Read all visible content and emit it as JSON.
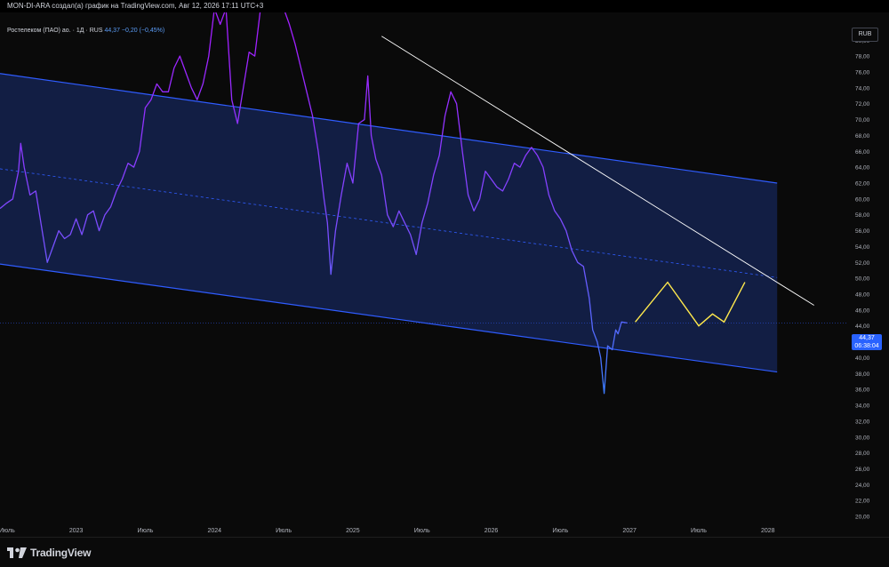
{
  "credit": "MON-DI-ARA создал(а) график на TradingView.com, Авг 12, 2026 17:11 UTC+3",
  "legend": {
    "symbol": "Ростелеком (ПАО) ао. · 1Д · RUS",
    "price": "44,37 −0,20 (−0,45%)"
  },
  "currency": "RUB",
  "last_price": {
    "value": "44,37",
    "countdown": "06:38:04"
  },
  "brand": "TradingView",
  "colors": {
    "line_low": "#3d7bff",
    "line_high": "#a11fff",
    "channel": "#2f5cff",
    "projection": "#ffe94d",
    "trendline": "#ffffff"
  },
  "chart_data": {
    "type": "line",
    "x_axis": {
      "unit": "months since Jul 2022",
      "ticks": [
        {
          "label": "Июль",
          "x": 0
        },
        {
          "label": "2023",
          "x": 6
        },
        {
          "label": "Июль",
          "x": 12
        },
        {
          "label": "2024",
          "x": 18
        },
        {
          "label": "Июль",
          "x": 24
        },
        {
          "label": "2025",
          "x": 30
        },
        {
          "label": "Июль",
          "x": 36
        },
        {
          "label": "2026",
          "x": 42
        },
        {
          "label": "Июль",
          "x": 48
        },
        {
          "label": "2027",
          "x": 54
        },
        {
          "label": "Июль",
          "x": 60
        },
        {
          "label": "2028",
          "x": 66
        }
      ]
    },
    "y_axis": {
      "range": [
        19,
        83.5
      ],
      "ticks": [
        "20,00",
        "22,00",
        "24,00",
        "26,00",
        "28,00",
        "30,00",
        "32,00",
        "34,00",
        "36,00",
        "38,00",
        "40,00",
        "42,00",
        "44,00",
        "46,00",
        "48,00",
        "50,00",
        "52,00",
        "54,00",
        "56,00",
        "58,00",
        "60,00",
        "62,00",
        "64,00",
        "66,00",
        "68,00",
        "70,00",
        "72,00",
        "74,00",
        "76,00",
        "78,00",
        "80,00"
      ]
    },
    "x_range": [
      -0.6,
      72.8
    ],
    "series": [
      {
        "name": "Ростелеком (ПАО) ао.",
        "points": [
          [
            -0.6,
            58.8
          ],
          [
            0,
            59.5
          ],
          [
            0.5,
            60.0
          ],
          [
            1.0,
            63.5
          ],
          [
            1.2,
            67.0
          ],
          [
            1.5,
            64.0
          ],
          [
            2.0,
            60.5
          ],
          [
            2.5,
            61.0
          ],
          [
            3.0,
            56.5
          ],
          [
            3.5,
            52.0
          ],
          [
            4.0,
            54.0
          ],
          [
            4.5,
            56.0
          ],
          [
            5.0,
            55.0
          ],
          [
            5.5,
            55.5
          ],
          [
            6.0,
            57.5
          ],
          [
            6.5,
            55.5
          ],
          [
            7.0,
            58.0
          ],
          [
            7.5,
            58.5
          ],
          [
            8.0,
            56.0
          ],
          [
            8.5,
            58.0
          ],
          [
            9.0,
            59.0
          ],
          [
            9.5,
            61.0
          ],
          [
            10.0,
            62.5
          ],
          [
            10.5,
            64.5
          ],
          [
            11.0,
            64.0
          ],
          [
            11.5,
            66.0
          ],
          [
            12.0,
            71.5
          ],
          [
            12.5,
            72.5
          ],
          [
            13.0,
            74.5
          ],
          [
            13.5,
            73.5
          ],
          [
            14.0,
            73.5
          ],
          [
            14.5,
            76.5
          ],
          [
            15.0,
            78.0
          ],
          [
            15.5,
            76.0
          ],
          [
            16.0,
            74.0
          ],
          [
            16.5,
            72.5
          ],
          [
            17.0,
            74.5
          ],
          [
            17.5,
            78.0
          ],
          [
            18.0,
            84.0
          ],
          [
            18.5,
            82.0
          ],
          [
            19.0,
            84.0
          ],
          [
            19.5,
            72.5
          ],
          [
            20.0,
            69.5
          ],
          [
            20.5,
            74.0
          ],
          [
            21.0,
            78.5
          ],
          [
            21.5,
            78.0
          ],
          [
            22.0,
            84.0
          ],
          [
            22.5,
            84.0
          ],
          [
            23.5,
            84.0
          ],
          [
            24.0,
            84.0
          ],
          [
            24.5,
            82.0
          ],
          [
            25.0,
            79.5
          ],
          [
            25.5,
            76.5
          ],
          [
            26.0,
            73.5
          ],
          [
            26.5,
            70.5
          ],
          [
            27.0,
            66.0
          ],
          [
            27.5,
            60.0
          ],
          [
            27.8,
            57.0
          ],
          [
            28.1,
            50.5
          ],
          [
            28.5,
            56.0
          ],
          [
            29.0,
            60.5
          ],
          [
            29.5,
            64.5
          ],
          [
            30.0,
            62.0
          ],
          [
            30.5,
            69.5
          ],
          [
            31.0,
            70.0
          ],
          [
            31.3,
            75.5
          ],
          [
            31.6,
            68.0
          ],
          [
            32.0,
            65.0
          ],
          [
            32.5,
            63.0
          ],
          [
            33.0,
            58.0
          ],
          [
            33.5,
            56.5
          ],
          [
            34.0,
            58.5
          ],
          [
            34.5,
            57.0
          ],
          [
            35.0,
            55.5
          ],
          [
            35.5,
            53.0
          ],
          [
            36.0,
            57.0
          ],
          [
            36.5,
            59.5
          ],
          [
            37.0,
            63.0
          ],
          [
            37.5,
            65.5
          ],
          [
            38.0,
            70.5
          ],
          [
            38.5,
            73.5
          ],
          [
            39.0,
            72.0
          ],
          [
            39.5,
            66.0
          ],
          [
            40.0,
            60.5
          ],
          [
            40.5,
            58.5
          ],
          [
            41.0,
            60.0
          ],
          [
            41.5,
            63.5
          ],
          [
            42.0,
            62.5
          ],
          [
            42.5,
            61.5
          ],
          [
            43.0,
            61.0
          ],
          [
            43.5,
            62.5
          ],
          [
            44.0,
            64.5
          ],
          [
            44.5,
            64.0
          ],
          [
            45.0,
            65.5
          ],
          [
            45.5,
            66.5
          ],
          [
            46.0,
            65.5
          ],
          [
            46.5,
            64.0
          ],
          [
            47.0,
            60.5
          ],
          [
            47.5,
            58.5
          ],
          [
            48.0,
            57.5
          ],
          [
            48.5,
            56.0
          ],
          [
            49.0,
            53.5
          ],
          [
            49.5,
            52.0
          ],
          [
            50.0,
            51.5
          ],
          [
            50.5,
            47.5
          ],
          [
            50.8,
            43.5
          ],
          [
            51.2,
            42.0
          ],
          [
            51.5,
            40.0
          ],
          [
            51.8,
            35.5
          ],
          [
            52.1,
            41.5
          ],
          [
            52.5,
            41.0
          ],
          [
            52.8,
            43.5
          ],
          [
            53.0,
            43.0
          ],
          [
            53.3,
            44.5
          ],
          [
            53.8,
            44.37
          ]
        ]
      },
      {
        "name": "Прогноз",
        "points": [
          [
            54.5,
            44.5
          ],
          [
            57.3,
            49.5
          ],
          [
            60.0,
            44.0
          ],
          [
            61.2,
            45.5
          ],
          [
            62.2,
            44.5
          ],
          [
            64.0,
            49.5
          ]
        ]
      }
    ],
    "channel": {
      "upper": [
        [
          -0.6,
          75.8
        ],
        [
          66.8,
          62.0
        ]
      ],
      "lower": [
        [
          -0.6,
          51.8
        ],
        [
          66.8,
          38.2
        ]
      ],
      "middle": [
        [
          -0.6,
          63.8
        ],
        [
          66.8,
          50.1
        ]
      ]
    },
    "trendline": [
      [
        32.5,
        80.5
      ],
      [
        70.0,
        46.6
      ]
    ],
    "current_price": 44.37,
    "grid": false
  }
}
